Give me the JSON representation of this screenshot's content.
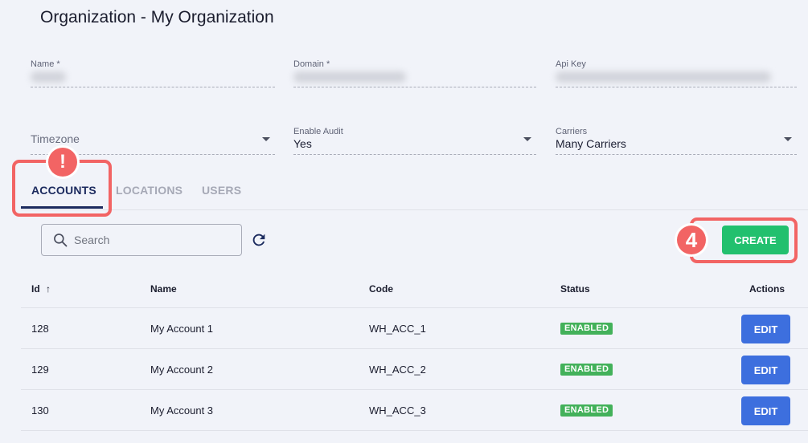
{
  "page": {
    "title": "Organization - My Organization"
  },
  "form": {
    "name_label": "Name *",
    "domain_label": "Domain *",
    "api_key_label": "Api Key",
    "timezone_placeholder": "Timezone",
    "enable_audit_label": "Enable Audit",
    "enable_audit_value": "Yes",
    "carriers_label": "Carriers",
    "carriers_value": "Many Carriers"
  },
  "tabs": [
    {
      "label": "ACCOUNTS",
      "active": true
    },
    {
      "label": "LOCATIONS",
      "active": false
    },
    {
      "label": "USERS",
      "active": false
    }
  ],
  "annotations": {
    "tab_badge": "!",
    "create_badge": "4",
    "highlight_color": "#f26464"
  },
  "toolbar": {
    "search_placeholder": "Search",
    "create_label": "CREATE"
  },
  "table": {
    "columns": [
      "Id",
      "Name",
      "Code",
      "Status",
      "Actions"
    ],
    "sort_indicator": "↑",
    "rows": [
      {
        "id": "128",
        "name": "My Account 1",
        "code": "WH_ACC_1",
        "status": "ENABLED",
        "action": "EDIT"
      },
      {
        "id": "129",
        "name": "My Account 2",
        "code": "WH_ACC_2",
        "status": "ENABLED",
        "action": "EDIT"
      },
      {
        "id": "130",
        "name": "My Account 3",
        "code": "WH_ACC_3",
        "status": "ENABLED",
        "action": "EDIT"
      }
    ]
  },
  "colors": {
    "primary": "#1b2a5e",
    "create": "#22c06e",
    "edit": "#3d6fde",
    "status_enabled": "#43b15a",
    "background": "#f1f3f9"
  }
}
